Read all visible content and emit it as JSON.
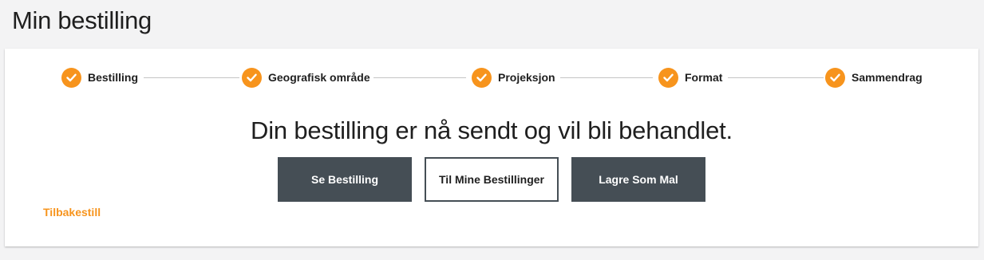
{
  "page": {
    "title": "Min bestilling"
  },
  "colors": {
    "accent": "#f7941d",
    "button_dark": "#454e55",
    "background": "#f3f3f4"
  },
  "stepper": {
    "steps": [
      {
        "label": "Bestilling",
        "status": "completed",
        "icon": "check-icon"
      },
      {
        "label": "Geografisk område",
        "status": "completed",
        "icon": "check-icon"
      },
      {
        "label": "Projeksjon",
        "status": "completed",
        "icon": "check-icon"
      },
      {
        "label": "Format",
        "status": "completed",
        "icon": "check-icon"
      },
      {
        "label": "Sammendrag",
        "status": "completed",
        "icon": "check-icon"
      }
    ]
  },
  "confirmation": {
    "message": "Din bestilling er nå sendt og vil bli behandlet."
  },
  "actions": {
    "view_order": "Se Bestilling",
    "my_orders": "Til Mine Bestillinger",
    "save_template": "Lagre Som Mal"
  },
  "reset": {
    "label": "Tilbakestill"
  }
}
